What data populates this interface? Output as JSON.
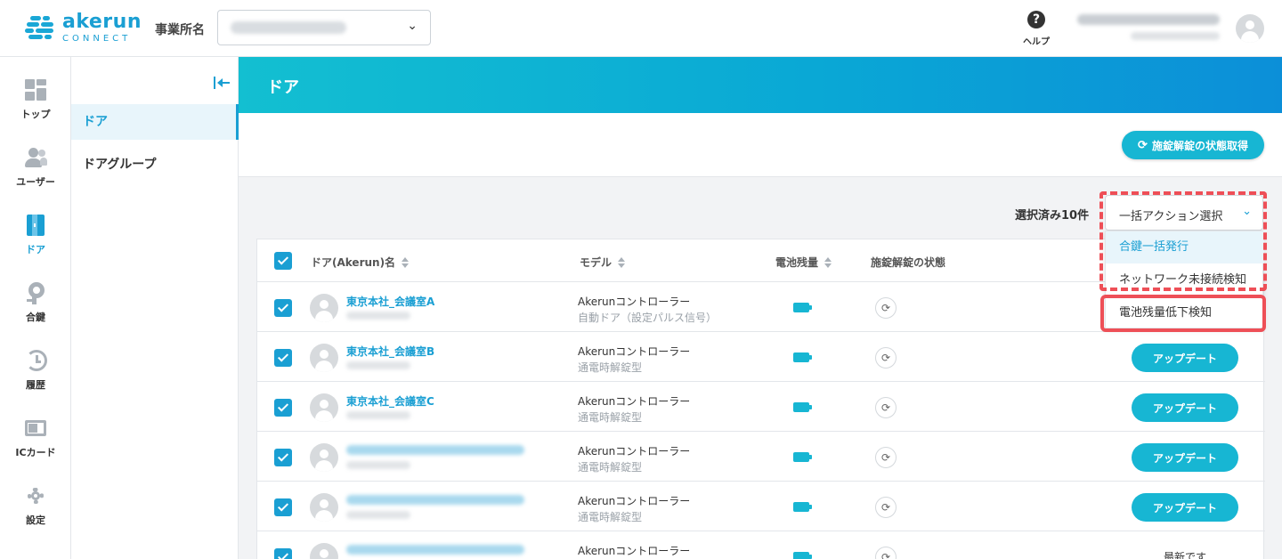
{
  "brand": {
    "name": "akerun",
    "sub": "CONNECT",
    "color": "#1a9fd3"
  },
  "header": {
    "office_label": "事業所名",
    "help_label": "ヘルプ"
  },
  "rail": {
    "items": [
      {
        "label": "トップ",
        "icon": "dashboard-icon"
      },
      {
        "label": "ユーザー",
        "icon": "user-icon"
      },
      {
        "label": "ドア",
        "icon": "door-icon",
        "active": true
      },
      {
        "label": "合鍵",
        "icon": "key-icon"
      },
      {
        "label": "履歴",
        "icon": "history-icon"
      },
      {
        "label": "ICカード",
        "icon": "ic-card-icon"
      },
      {
        "label": "設定",
        "icon": "gear-icon"
      }
    ]
  },
  "subnav": {
    "items": [
      {
        "label": "ドア",
        "active": true
      },
      {
        "label": "ドアグループ"
      }
    ]
  },
  "page": {
    "title": "ドア",
    "refresh_button": "施錠解錠の状態取得",
    "selected_count": "選択済み10件"
  },
  "bulk_action": {
    "selected": "一括アクション選択",
    "options": [
      "合鍵一括発行",
      "ネットワーク未接続検知",
      "電池残量低下検知"
    ]
  },
  "table": {
    "columns": [
      "ドア(Akerun)名",
      "モデル",
      "電池残量",
      "施錠解錠の状態"
    ],
    "rows": [
      {
        "name": "東京本社_会議室A",
        "model": "Akerunコントローラー",
        "model_sub": "自動ドア（設定パルス信号）",
        "action": ""
      },
      {
        "name": "東京本社_会議室B",
        "model": "Akerunコントローラー",
        "model_sub": "通電時解錠型",
        "action": "アップデート"
      },
      {
        "name": "東京本社_会議室C",
        "model": "Akerunコントローラー",
        "model_sub": "通電時解錠型",
        "action": "アップデート"
      },
      {
        "name": "",
        "model": "Akerunコントローラー",
        "model_sub": "通電時解錠型",
        "action": "アップデート"
      },
      {
        "name": "",
        "model": "Akerunコントローラー",
        "model_sub": "通電時解錠型",
        "action": "アップデート"
      },
      {
        "name": "",
        "model": "Akerunコントローラー",
        "model_sub": "",
        "status_text": "最新です"
      }
    ]
  },
  "colors": {
    "accent": "#17b6d3",
    "highlight": "#ee4f57"
  }
}
